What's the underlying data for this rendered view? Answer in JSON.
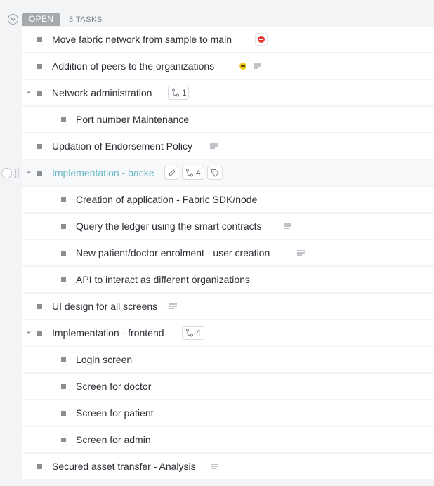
{
  "group": {
    "status": "OPEN",
    "task_count": "8 TASKS",
    "status_color": "#a5a8ad"
  },
  "tasks": [
    {
      "title": "Move fabric network from sample to main",
      "status_badge": "blocked",
      "badge_color": "#e5352e"
    },
    {
      "title": "Addition of peers to the organizations",
      "status_badge": "on-hold",
      "badge_color": "#f2c81a",
      "has_description": true
    },
    {
      "title": "Network administration",
      "subtasks_count": "1",
      "expanded": true,
      "subtasks": [
        {
          "title": "Port number Maintenance"
        }
      ]
    },
    {
      "title": "Updation of Endorsement Policy",
      "has_description": true
    },
    {
      "title": "Implementation - backe",
      "subtasks_count": "4",
      "expanded": true,
      "hovered": true,
      "subtasks": [
        {
          "title": "Creation of application - Fabric SDK/node"
        },
        {
          "title": "Query the ledger using the smart contracts",
          "has_description": true
        },
        {
          "title": "New patient/doctor enrolment - user creation",
          "has_description": true
        },
        {
          "title": "API to interact as different organizations"
        }
      ]
    },
    {
      "title": "UI design for all screens",
      "has_description": true
    },
    {
      "title": "Implementation - frontend",
      "subtasks_count": "4",
      "expanded": true,
      "subtasks": [
        {
          "title": "Login screen"
        },
        {
          "title": "Screen for doctor"
        },
        {
          "title": "Screen for patient"
        },
        {
          "title": "Screen for admin"
        }
      ]
    },
    {
      "title": "Secured asset transfer - Analysis",
      "has_description": true
    }
  ],
  "icons": {
    "collapse": "chevron-down-icon",
    "subtask": "subtask-icon",
    "description": "description-lines-icon",
    "edit": "pencil-icon",
    "tag": "tag-icon",
    "drag": "drag-handle-icon"
  }
}
